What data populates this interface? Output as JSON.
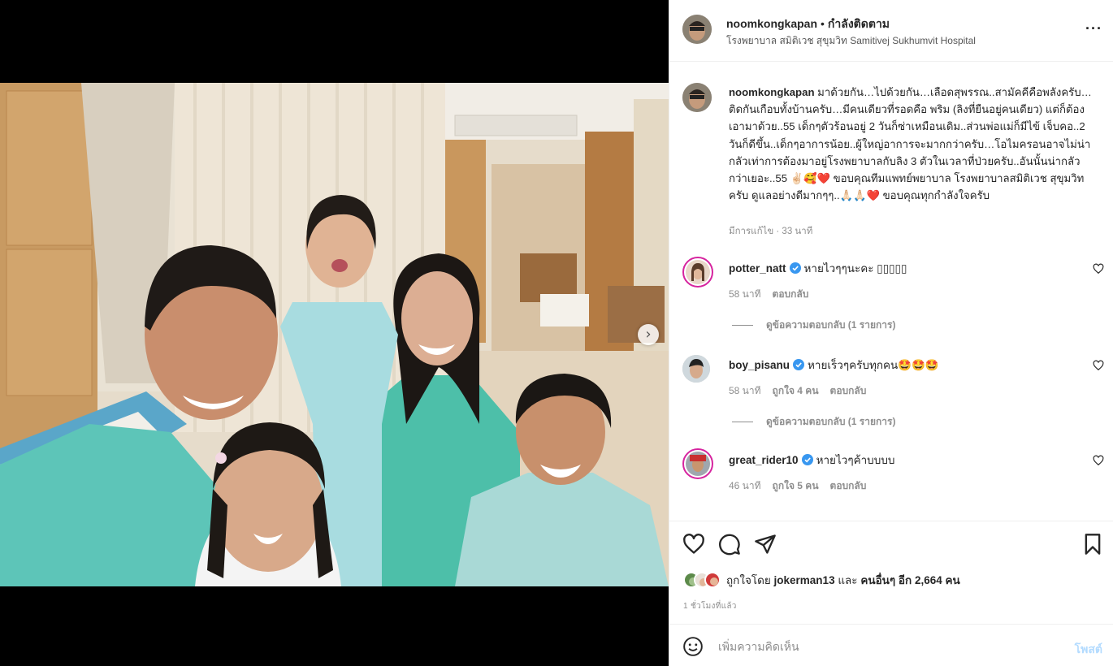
{
  "post": {
    "username": "noomkongkapan",
    "separator": "•",
    "follow_label": "กำลังติดตาม",
    "location": "โรงพยาบาล สมิติเวช สุขุมวิท Samitivej Sukhumvit Hospital",
    "more_label": "···",
    "next_label": "›"
  },
  "caption": {
    "username": "noomkongkapan",
    "text": " มาด้วยกัน…ไปด้วยกัน…เลือดสุพรรณ..สามัคคีคือพลังครับ…ติดกันเกือบทั้งบ้านครับ…มีคนเดียวที่รอดคือ พริม (ลิงที่ยืนอยู่คนเดียว) แต่ก็ต้องเอามาด้วย..55 เด็กๆตัวร้อนอยู่ 2 วันก็ซ่าเหมือนเดิม..ส่วนพ่อแม่ก็มีไข้ เจ็บคอ..2 วันก็ดีขึ้น..เด็กๆอาการน้อย..ผู้ใหญ่อาการจะมากกว่าครับ…โอไมครอนอาจไม่น่ากลัวเท่าการต้องมาอยู่โรงพยาบาลกับลิง 3 ตัวในเวลาที่ป่วยครับ..อันนั้นน่ากลัวกว่าเยอะ..55 ✌🏻🥰❤️ ขอบคุณทีมแพทย์พยาบาล โรงพยาบาลสมิติเวช สุขุมวิทครับ ดูแลอย่างดีมากๆๆ..🙏🏻🙏🏻❤️ ขอบคุณทุกกำลังใจครับ",
    "edited": "มีการแก้ไข · 33 นาที"
  },
  "comments": [
    {
      "username": "potter_natt",
      "text": "หายไวๆๆนะคะ ▯▯▯▯▯",
      "time": "58 นาที",
      "likes": "",
      "reply_label": "ตอบกลับ",
      "view_replies": "ดูข้อความตอบกลับ (1 รายการ)"
    },
    {
      "username": "boy_pisanu",
      "text": "หายเร็วๆครับทุกคน🤩🤩🤩",
      "time": "58 นาที",
      "likes": "ถูกใจ 4 คน",
      "reply_label": "ตอบกลับ",
      "view_replies": "ดูข้อความตอบกลับ (1 รายการ)"
    },
    {
      "username": "great_rider10",
      "text": "หายไวๆค้าบบบบ",
      "time": "46 นาที",
      "likes": "ถูกใจ 5 คน",
      "reply_label": "ตอบกลับ",
      "view_replies": ""
    }
  ],
  "likes": {
    "prefix": "ถูกใจโดย ",
    "user": "jokerman13",
    "middle": " และ ",
    "others": "คนอื่นๆ อีก 2,664 คน"
  },
  "timestamp": "1 ชั่วโมงที่แล้ว",
  "add_comment": {
    "placeholder": "เพิ่มความคิดเห็น",
    "post_label": "โพสต์"
  },
  "colors": {
    "verified": "#3897f0",
    "post_button_disabled": "#b3dbff",
    "story_ring": "#d6249f"
  },
  "icons": [
    "heart-icon",
    "comment-icon",
    "share-icon",
    "bookmark-icon",
    "emoji-icon",
    "verified-icon",
    "more-icon",
    "chevron-right-icon"
  ]
}
